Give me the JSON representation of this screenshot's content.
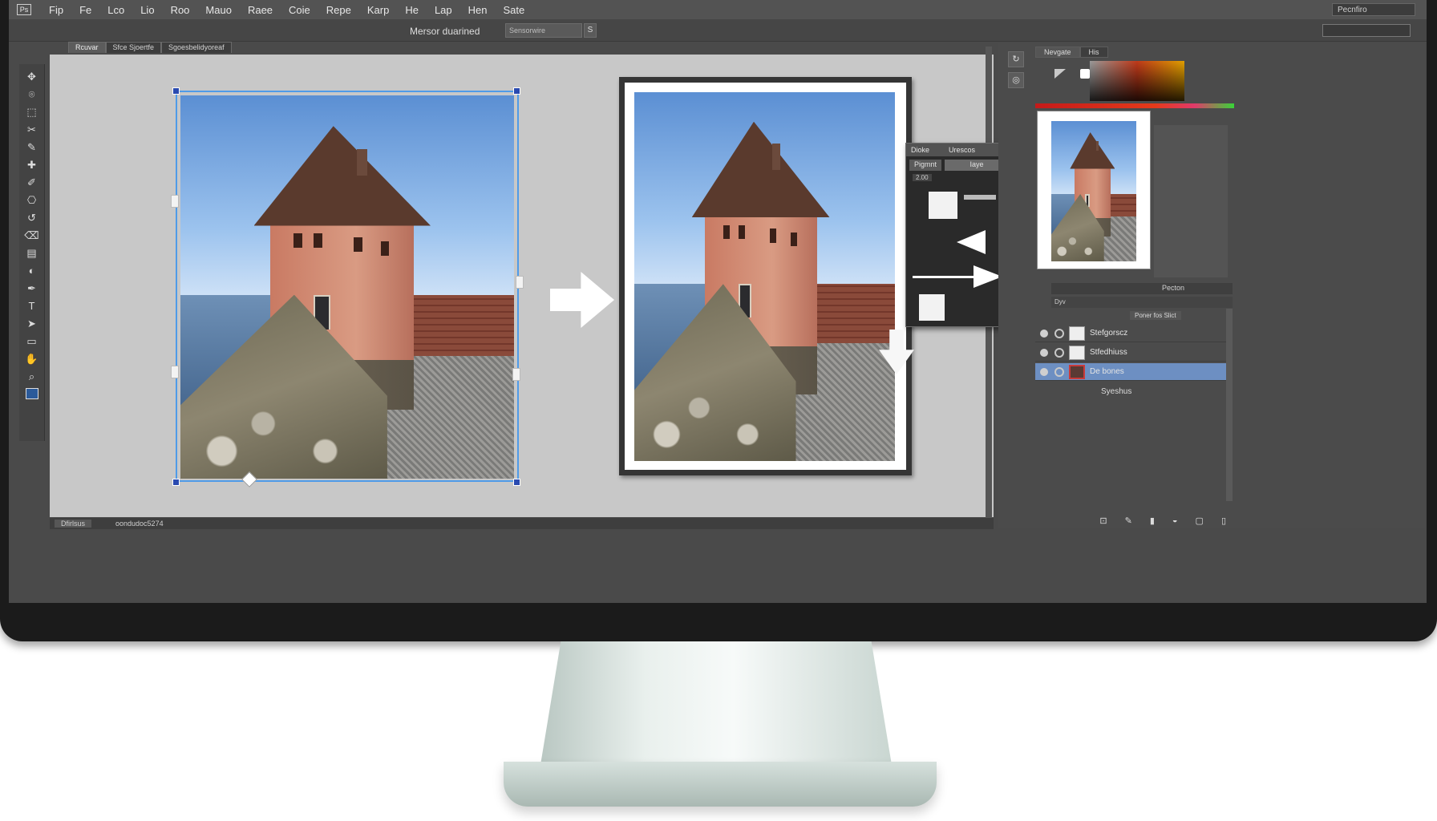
{
  "menubar": {
    "logo": "Ps",
    "items": [
      "Fip",
      "Fe",
      "Lco",
      "Lio",
      "Roo",
      "Mauo",
      "Raee",
      "Coie",
      "Repe",
      "Karp",
      "He",
      "Lap",
      "Hen",
      "Sate"
    ],
    "right_label": "Pecnfiro"
  },
  "options": {
    "label": "Mersor duarined",
    "field_value": "Sensorwire",
    "field_button": "S"
  },
  "doc_tabs": [
    "Rcuvar",
    "Sfce Sjoertfe",
    "Sgoesbelidyoreaf"
  ],
  "toolbox": {
    "tools": [
      "move-tool",
      "lasso-tool",
      "quick-select-tool",
      "crop-tool",
      "eyedropper-tool",
      "healing-tool",
      "brush-tool",
      "stamp-tool",
      "history-brush-tool",
      "eraser-tool",
      "gradient-tool",
      "dodge-tool",
      "pen-tool",
      "type-tool",
      "path-select-tool",
      "shape-tool",
      "hand-tool",
      "zoom-tool"
    ],
    "glyphs": [
      "✥",
      "⌾",
      "⬚",
      "✂",
      "✎",
      "✚",
      "✐",
      "⎔",
      "↺",
      "⌫",
      "▤",
      "◐",
      "✒",
      "T",
      "➤",
      "▭",
      "✋",
      "⌕"
    ]
  },
  "statusbar": {
    "zoom": "Dfirlsus",
    "doc_info": "oondudoc5274"
  },
  "dialog": {
    "title_left": "Dioke",
    "title_main": "Urescos",
    "tab1": "Pigmnt",
    "tab2": "Iaye",
    "readout": "2.00"
  },
  "panels": {
    "tabs": [
      "Nevgate",
      "His"
    ],
    "layers_header": "Pecton",
    "layers_sub": "Dyv",
    "layers_opts": "Poner fos Slict",
    "layers": [
      {
        "name": "Stefgorscz",
        "active": false
      },
      {
        "name": "Stfedhiuss",
        "active": false
      },
      {
        "name": "De bones",
        "active": true
      }
    ],
    "effects_label": "Syeshus"
  },
  "colors": {
    "accent": "#4f9be8",
    "handle": "#2a4ab0",
    "active_layer": "#6d8fc2"
  }
}
